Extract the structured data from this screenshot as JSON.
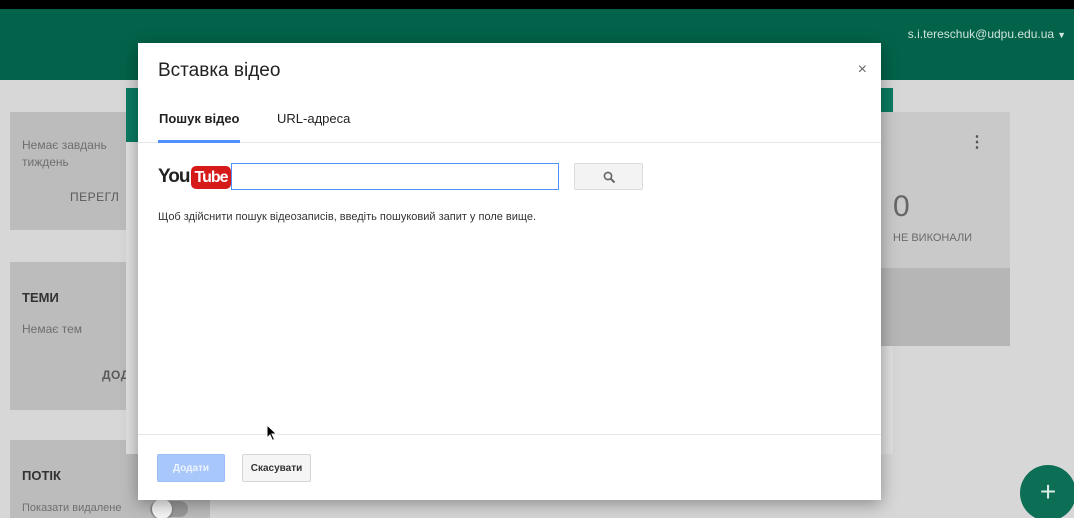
{
  "header": {
    "account_email": "s.i.tereschuk@udpu.edu.ua"
  },
  "background": {
    "left_card_1": {
      "text_line_1": "Немає завдань",
      "text_line_2": "тиждень",
      "button": "ПЕРЕГЛ"
    },
    "topics_card": {
      "title": "ТЕМИ",
      "empty_text": "Немає тем",
      "button": "ДОД"
    },
    "stream_card": {
      "title": "ПОТІК",
      "toggle_label": "Показати видалене"
    },
    "stats": {
      "count": "0",
      "label": "НЕ ВИКОНАЛИ"
    }
  },
  "modal": {
    "title": "Вставка відео",
    "close_label": "×",
    "tabs": [
      {
        "label": "Пошук відео",
        "active": true
      },
      {
        "label": "URL-адреса",
        "active": false
      }
    ],
    "logo": {
      "you": "You",
      "tube": "Tube"
    },
    "search": {
      "value": "",
      "placeholder": ""
    },
    "hint": "Щоб здійснити пошук відеозаписів, введіть пошуковий запит у поле вище.",
    "footer": {
      "add_label": "Додати",
      "cancel_label": "Скасувати"
    }
  },
  "colors": {
    "topbar": "#03634a",
    "accent_blue": "#4d90fe",
    "youtube_red": "#d61a1a",
    "fab": "#0b6e55"
  },
  "icons": {
    "search_button": "search-icon",
    "fab": "plus-icon",
    "account_menu": "caret-down-icon",
    "card_menu": "more-vert-icon"
  }
}
